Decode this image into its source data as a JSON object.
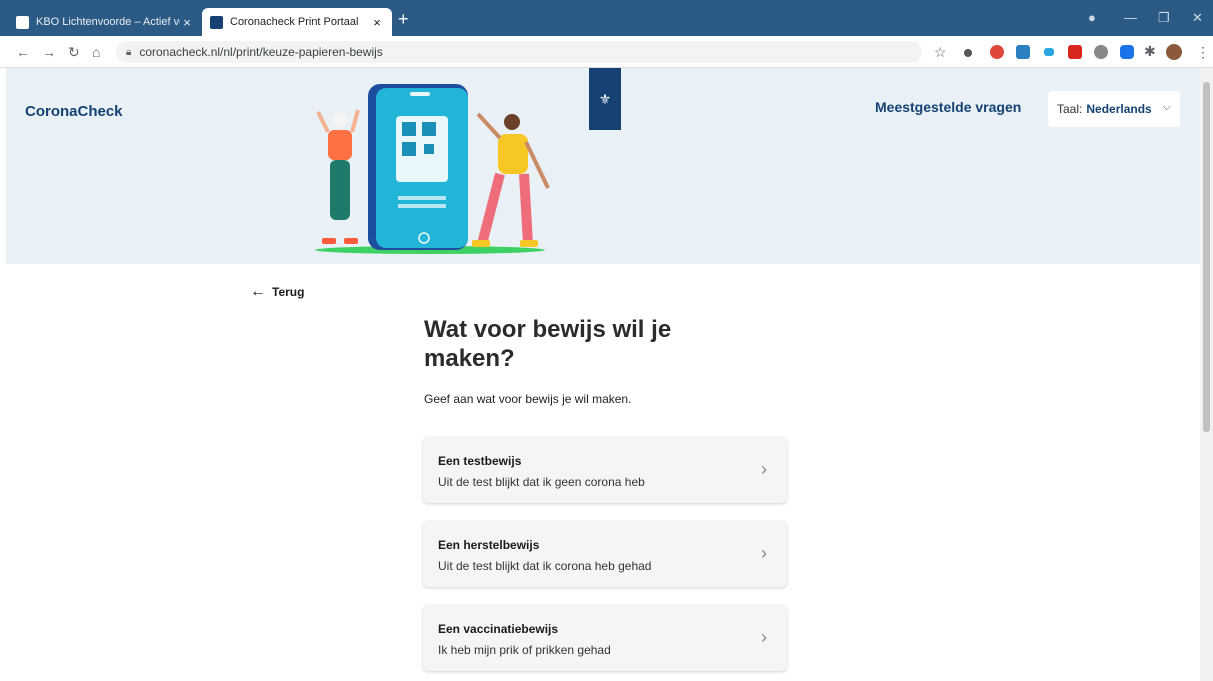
{
  "browser": {
    "tabs": [
      {
        "title": "KBO Lichtenvoorde – Actief voor",
        "close": "×",
        "active": false
      },
      {
        "title": "Coronacheck Print Portaal",
        "close": "×",
        "active": true
      }
    ],
    "new_tab": "+",
    "url": "coronacheck.nl/nl/print/keuze-papieren-bewijs",
    "window_controls": {
      "minimize": "—",
      "restore": "❐",
      "close": "✕"
    }
  },
  "header": {
    "brand": "CoronaCheck",
    "faq_link": "Meestgestelde vragen",
    "language": {
      "label": "Taal:",
      "value": "Nederlands"
    }
  },
  "main": {
    "back_label": "Terug",
    "title": "Wat voor bewijs wil je maken?",
    "intro": "Geef aan wat voor bewijs je wil maken.",
    "options": [
      {
        "title": "Een testbewijs",
        "subtitle": "Uit de test blijkt dat ik geen corona heb"
      },
      {
        "title": "Een herstelbewijs",
        "subtitle": "Uit de test blijkt dat ik corona heb gehad"
      },
      {
        "title": "Een vaccinatiebewijs",
        "subtitle": "Ik heb mijn prik of prikken gehad"
      }
    ]
  },
  "colors": {
    "chrome": "#2b5a85",
    "brand": "#154273",
    "hero_bg": "#e9f1f6"
  }
}
